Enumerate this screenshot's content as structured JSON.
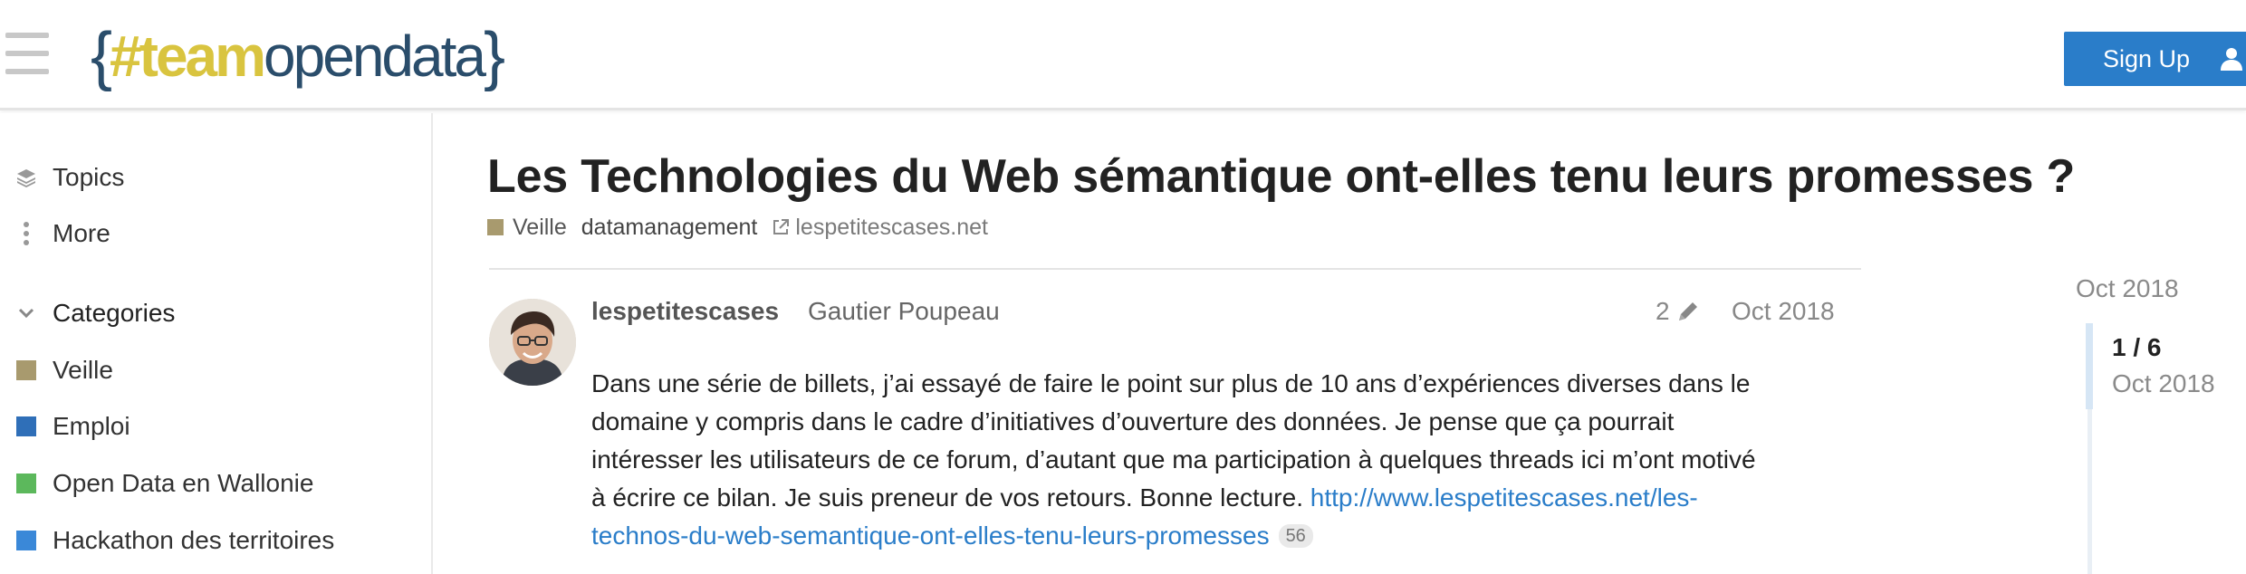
{
  "header": {
    "logo": {
      "brace_open": "{",
      "hash": "#",
      "team": "team",
      "opendata": "opendata",
      "brace_close": "}"
    },
    "signup_label": "Sign Up",
    "icons": {
      "menu": "hamburger-menu-icon",
      "login": "user-icon"
    }
  },
  "sidebar": {
    "items": [
      {
        "label": "Topics",
        "icon": "layers-icon"
      },
      {
        "label": "More",
        "icon": "vertical-ellipsis-icon"
      }
    ],
    "categories_header": "Categories",
    "categories": [
      {
        "label": "Veille",
        "color": "#a89a6e"
      },
      {
        "label": "Emploi",
        "color": "#2f6fb8"
      },
      {
        "label": "Open Data en Wallonie",
        "color": "#5cb85c"
      },
      {
        "label": "Hackathon des territoires",
        "color": "#3a88d8"
      }
    ]
  },
  "topic": {
    "title": "Les Technologies du Web sémantique ont-elles tenu leurs promesses ?",
    "category": "Veille",
    "category_color": "#a89a6e",
    "tag": "datamanagement",
    "external_domain": "lespetitescases.net"
  },
  "post": {
    "username": "lespetitescases",
    "full_name": "Gautier Poupeau",
    "edit_count": "2",
    "date": "Oct 2018",
    "body_lines": [
      "Dans une série de billets, j’ai essayé de faire le point sur plus de 10 ans d’expériences diverses dans le",
      "domaine y compris dans le cadre d’initiatives d’ouverture des données. Je pense que ça pourrait",
      "intéresser les utilisateurs de ce forum, d’autant que ma participation à quelques threads ici m’ont motivé",
      "à écrire ce bilan. Je suis preneur de vos retours. Bonne lecture. "
    ],
    "link_part1": "http://www.lespetitescases.net/les-",
    "link_part2": "technos-du-web-semantique-ont-elles-tenu-leurs-promesses",
    "link_clicks": "56"
  },
  "timeline": {
    "top_date": "Oct 2018",
    "position": "1 / 6",
    "current_date": "Oct 2018"
  }
}
